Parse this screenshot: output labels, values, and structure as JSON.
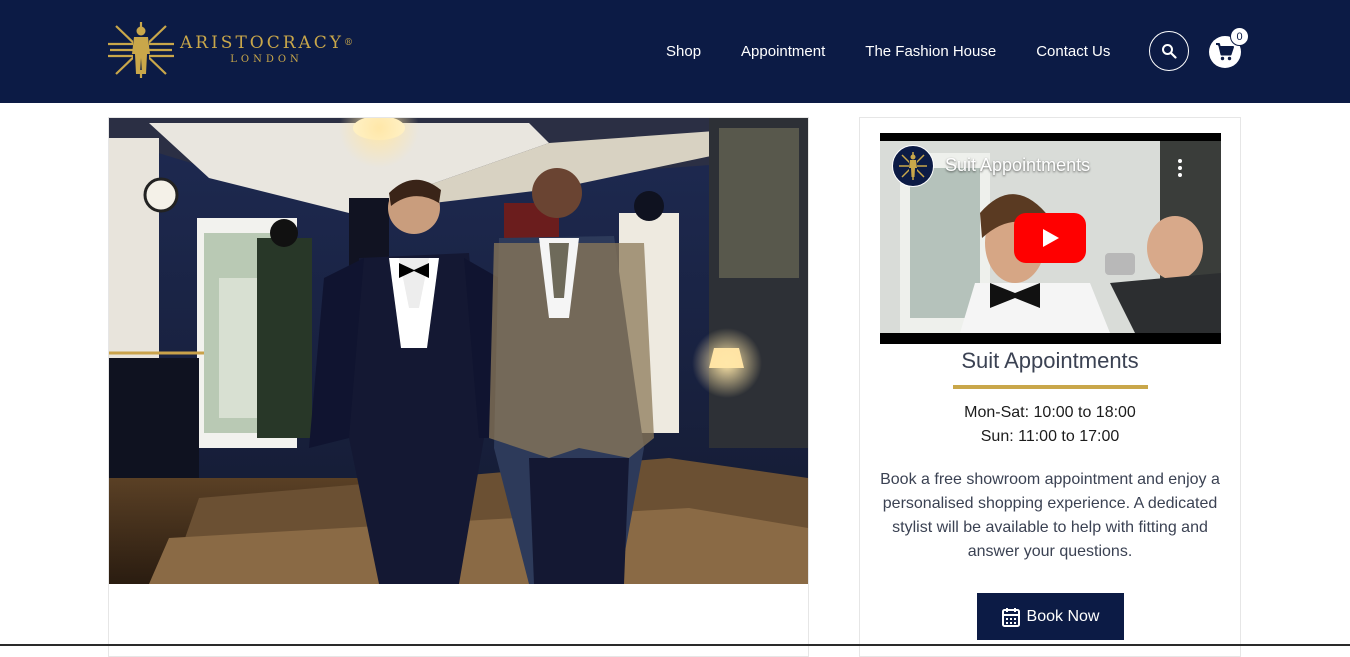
{
  "brand": {
    "name": "ARISTOCRACY",
    "registered": "®",
    "city": "LONDON",
    "primary_color": "#0c1b45",
    "accent_color": "#c9a74a"
  },
  "nav": {
    "items": [
      {
        "label": "Shop"
      },
      {
        "label": "Appointment"
      },
      {
        "label": "The Fashion House"
      },
      {
        "label": "Contact Us"
      }
    ],
    "search_icon": "search-icon",
    "cart_icon": "cart-icon",
    "cart_count": "0"
  },
  "hero": {
    "image_alt": "Two models in tuxedos in the showroom"
  },
  "video": {
    "title": "Suit Appointments",
    "play_icon": "play-icon",
    "menu_icon": "more-vertical-icon"
  },
  "appointment": {
    "title": "Suit Appointments",
    "hours_weekday": "Mon-Sat: 10:00 to 18:00",
    "hours_sunday": "Sun: 11:00 to 17:00",
    "description": "Book a free showroom appointment and enjoy a personalised shopping experience. A dedicated stylist will be available to help with fitting and answer your questions.",
    "button_label": "Book Now",
    "button_icon": "calendar-icon"
  }
}
